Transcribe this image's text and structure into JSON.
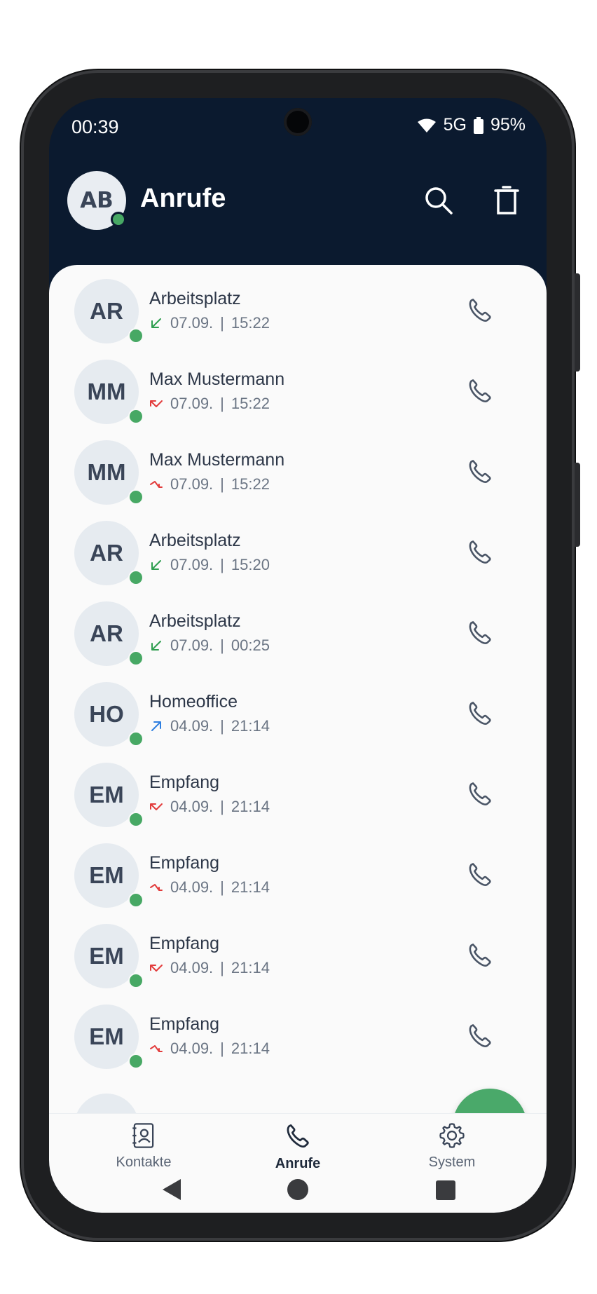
{
  "status": {
    "time": "00:39",
    "network": "5G",
    "battery": "95%"
  },
  "appbar": {
    "avatar_initials": "AB",
    "title": "Anrufe"
  },
  "calls": [
    {
      "initials": "AR",
      "name": "Arbeitsplatz",
      "type": "incoming",
      "date": "07.09.",
      "time": "15:22"
    },
    {
      "initials": "MM",
      "name": "Max Mustermann",
      "type": "missed",
      "date": "07.09.",
      "time": "15:22"
    },
    {
      "initials": "MM",
      "name": "Max Mustermann",
      "type": "rejected",
      "date": "07.09.",
      "time": "15:22"
    },
    {
      "initials": "AR",
      "name": "Arbeitsplatz",
      "type": "incoming",
      "date": "07.09.",
      "time": "15:20"
    },
    {
      "initials": "AR",
      "name": "Arbeitsplatz",
      "type": "incoming",
      "date": "07.09.",
      "time": "00:25"
    },
    {
      "initials": "HO",
      "name": "Homeoffice",
      "type": "outgoing",
      "date": "04.09.",
      "time": "21:14"
    },
    {
      "initials": "EM",
      "name": "Empfang",
      "type": "missed",
      "date": "04.09.",
      "time": "21:14"
    },
    {
      "initials": "EM",
      "name": "Empfang",
      "type": "rejected",
      "date": "04.09.",
      "time": "21:14"
    },
    {
      "initials": "EM",
      "name": "Empfang",
      "type": "missed",
      "date": "04.09.",
      "time": "21:14"
    },
    {
      "initials": "EM",
      "name": "Empfang",
      "type": "rejected",
      "date": "04.09.",
      "time": "21:14"
    }
  ],
  "colors": {
    "incoming": "#2e9e4f",
    "missed": "#e23b3b",
    "rejected": "#e23b3b",
    "outgoing": "#2f7fe0",
    "online": "#47a864",
    "header": "#0b1a2f",
    "fab": "#4aa96a"
  },
  "bottom_nav": {
    "contacts": "Kontakte",
    "calls": "Anrufe",
    "system": "System"
  }
}
